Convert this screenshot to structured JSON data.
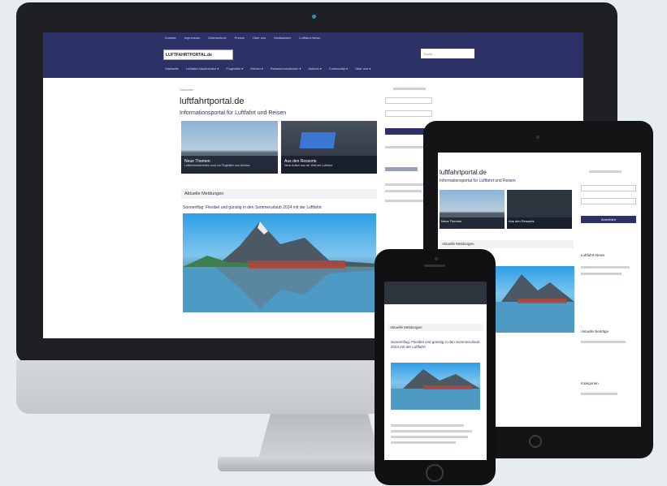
{
  "site": {
    "title": "luftfahrtportal.de",
    "subtitle": "Informationsportal für Luftfahrt und Reisen",
    "logo_text": "LUFTFAHRTPORTAL.de",
    "search_placeholder": "Suche...",
    "breadcrumb": "Startseite",
    "top_links": [
      "Kontakt",
      "Impressum",
      "Datenschutz",
      "Presse",
      "Über uns",
      "Mediadaten",
      "Luftfahrt-News"
    ],
    "main_nav": [
      "Startseite",
      "Luftfahrt-Nachrichten ▾",
      "Flughäfen ▾",
      "Reisen ▾",
      "Reiseinformationen ▾",
      "Airlines ▾",
      "Community ▾",
      "Über uns ▾"
    ],
    "featured": [
      {
        "caption": "Neue Themen",
        "text": "Luftfahrtnachrichten rund um Flughäfen und Airlines"
      },
      {
        "caption": "Aus den Ressorts",
        "text": "Neue Artikel aus der Welt der Luftfahrt"
      }
    ],
    "section_latest": "Aktuelle Meldungen",
    "article_title": "Sonnenflug: Flexibel und günstig in den Sommerurlaub 2024 mit der Luftfahrt"
  },
  "tablet": {
    "title": "luftfahrtportal.de",
    "subtitle": "Informationsportal für Luftfahrt und Reisen",
    "section_latest": "Aktuelle Meldungen",
    "featured": [
      "Neue Themen",
      "Aus den Ressorts"
    ],
    "sidebar_headings": [
      "Luftfahrt-News",
      "Aktuelle Beiträge",
      "Kategorien"
    ],
    "login_button": "Anmelden"
  },
  "phone": {
    "section_latest": "Aktuelle Meldungen",
    "article_title": "Sonnenflug: Flexibel und günstig in den Sommerurlaub 2024 mit der Luftfahrt"
  },
  "colors": {
    "header": "#2c3266",
    "device_dark": "#1f2023",
    "accent": "#2c3266"
  }
}
